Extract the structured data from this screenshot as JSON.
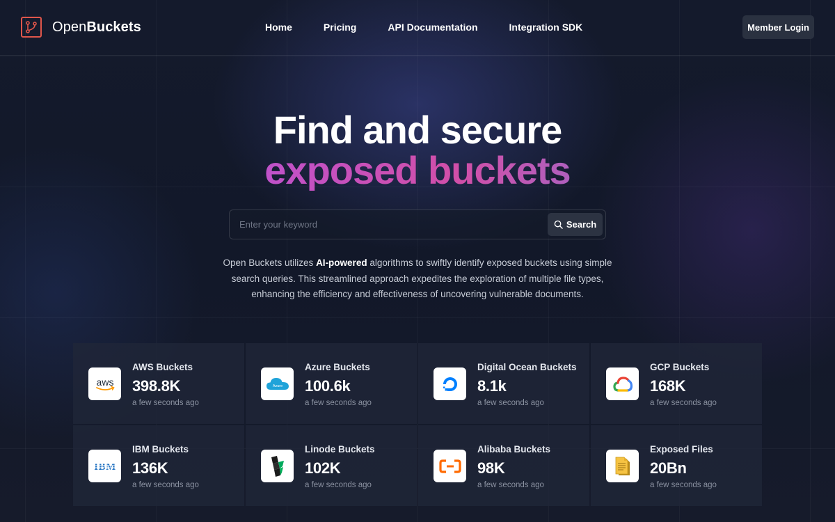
{
  "brand": {
    "prefix": "Open",
    "suffix": "Buckets",
    "accent": "#e0564b"
  },
  "nav": {
    "home": "Home",
    "pricing": "Pricing",
    "api": "API Documentation",
    "sdk": "Integration SDK"
  },
  "login": "Member Login",
  "hero": {
    "line1": "Find and secure",
    "line2": "exposed buckets"
  },
  "search": {
    "placeholder": "Enter your keyword",
    "button": "Search"
  },
  "description": {
    "before": "Open Buckets utilizes ",
    "bold": "AI-powered",
    "after": " algorithms to swiftly identify exposed buckets using simple search queries. This streamlined approach expedites the exploration of multiple file types, enhancing the efficiency and effectiveness of uncovering vulnerable documents."
  },
  "stats": [
    {
      "icon": "aws-icon",
      "label": "AWS Buckets",
      "value": "398.8K",
      "time": "a few seconds ago"
    },
    {
      "icon": "azure-icon",
      "label": "Azure Buckets",
      "value": "100.6k",
      "time": "a few seconds ago"
    },
    {
      "icon": "digitalocean-icon",
      "label": "Digital Ocean Buckets",
      "value": "8.1k",
      "time": "a few seconds ago"
    },
    {
      "icon": "gcp-icon",
      "label": "GCP Buckets",
      "value": "168K",
      "time": "a few seconds ago"
    },
    {
      "icon": "ibm-icon",
      "label": "IBM Buckets",
      "value": "136K",
      "time": "a few seconds ago"
    },
    {
      "icon": "linode-icon",
      "label": "Linode Buckets",
      "value": "102K",
      "time": "a few seconds ago"
    },
    {
      "icon": "alibaba-icon",
      "label": "Alibaba Buckets",
      "value": "98K",
      "time": "a few seconds ago"
    },
    {
      "icon": "file-icon",
      "label": "Exposed Files",
      "value": "20Bn",
      "time": "a few seconds ago"
    }
  ],
  "icon_text": {
    "aws": "aws",
    "azure": "Azure",
    "ibm": "IBM"
  }
}
